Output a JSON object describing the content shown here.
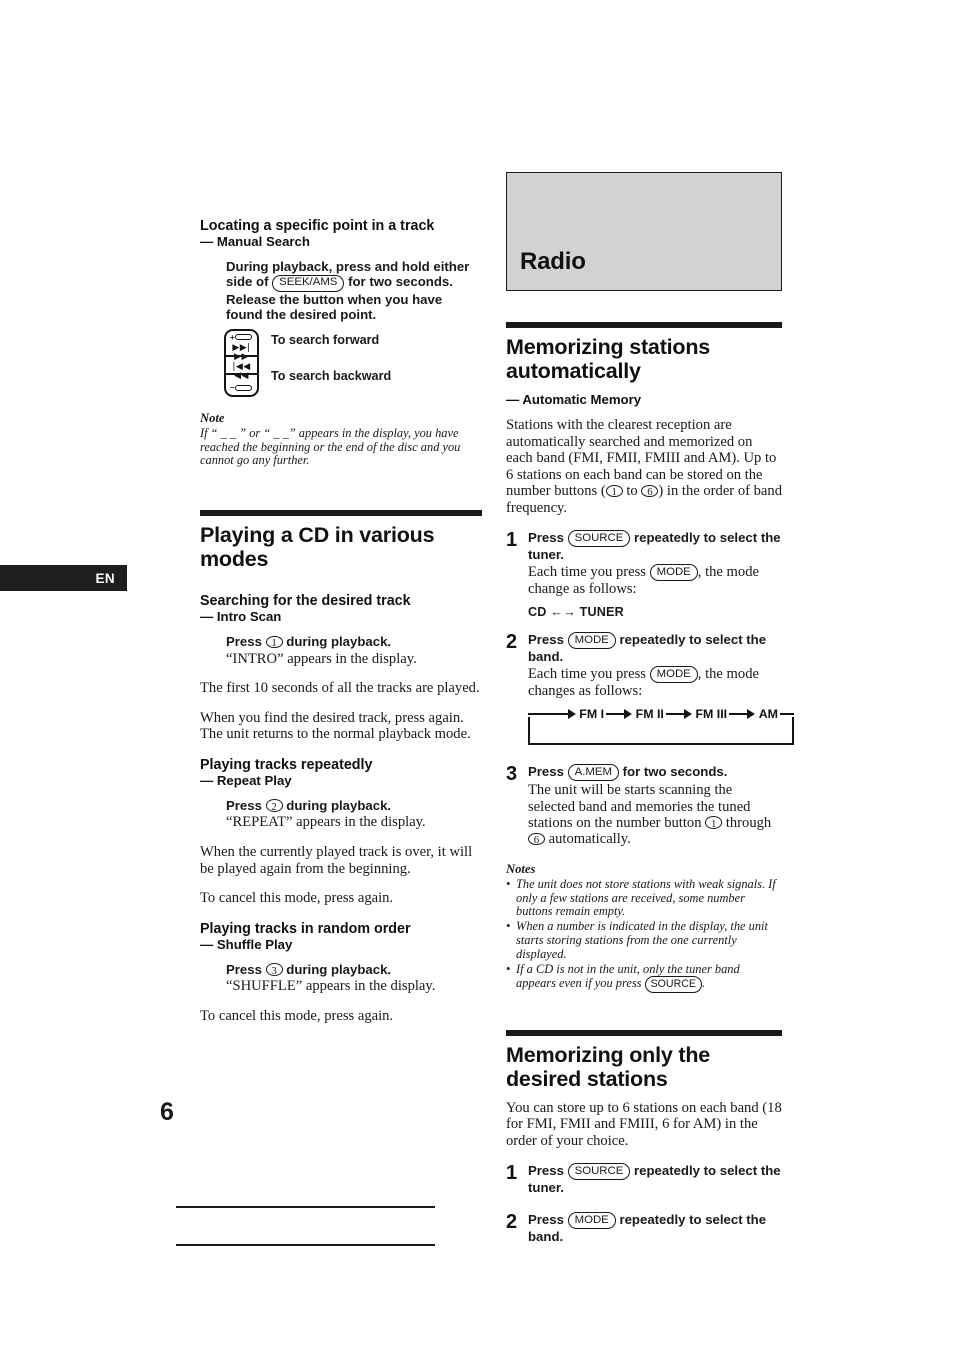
{
  "page": {
    "number": "6",
    "language_tab": "EN"
  },
  "left_column": {
    "section_manual_search": {
      "heading": "Locating a specific point in a track",
      "subheading": "— Manual Search",
      "instruction_pre": "During playback, press and hold either side of",
      "instruction_button": "SEEK/AMS",
      "instruction_post": "for two seconds. Release the button when you have found the desired point.",
      "illustration": {
        "forward_label": "To search forward",
        "backward_label": "To search backward",
        "plus_sign": "+",
        "minus_sign": "–",
        "forward_arrows": "▶▶| ▶▶",
        "backward_arrows": "|◀◀ ◀◀"
      },
      "note_heading": "Note",
      "note_text": "If “ _ _     ” or “     _ _” appears in the display, you have reached the beginning or the end of the disc and you cannot go any further."
    },
    "section_various_modes": {
      "heading": "Playing a CD in various modes",
      "intro_scan": {
        "heading": "Searching for the desired track",
        "subheading": "— Intro Scan",
        "instruction_pre": "Press",
        "instruction_button": "1",
        "instruction_post": "during playback.",
        "display_text": "“INTRO” appears in the display.",
        "paragraph_1": "The first 10 seconds of all the tracks are played.",
        "paragraph_2": "When you find the desired track, press again. The unit returns to the normal playback mode."
      },
      "repeat_play": {
        "heading": "Playing tracks repeatedly",
        "subheading": "— Repeat Play",
        "instruction_pre": "Press",
        "instruction_button": "2",
        "instruction_post": "during playback.",
        "display_text": "“REPEAT” appears in the display.",
        "paragraph_1": "When the currently played track is over, it will be played again from the beginning.",
        "paragraph_2": "To cancel this mode, press again."
      },
      "shuffle_play": {
        "heading": "Playing tracks in random order",
        "subheading": "— Shuffle Play",
        "instruction_pre": "Press",
        "instruction_button": "3",
        "instruction_post": "during playback.",
        "display_text": "“SHUFFLE” appears in the display.",
        "paragraph_1": "To cancel this mode, press again."
      }
    }
  },
  "right_column": {
    "chapter": {
      "title": "Radio"
    },
    "section_automatic_memory": {
      "heading": "Memorizing stations automatically",
      "subheading": "— Automatic Memory",
      "intro_a": "Stations with the clearest reception are automatically searched and memorized on each band (FMI, FMII, FMIII and AM). Up to 6 stations on each band can be stored on the number buttons (",
      "intro_btn_1": "1",
      "intro_b": "to",
      "intro_btn_6": "6",
      "intro_c": ") in the order of band frequency.",
      "steps": [
        {
          "number": "1",
          "instr_pre": "Press",
          "instr_button": "SOURCE",
          "instr_post": "repeatedly to select the tuner.",
          "sub_pre": "Each time you press",
          "sub_button": "MODE",
          "sub_post": ", the mode change as follows:",
          "mode_line": "CD ←→ TUNER"
        },
        {
          "number": "2",
          "instr_pre": "Press",
          "instr_button": "MODE",
          "instr_post": "repeatedly to select the band.",
          "sub_pre": "Each time you press",
          "sub_button": "MODE",
          "sub_post": ", the mode changes as follows:",
          "band_sequence": [
            "FM I",
            "FM II",
            "FM III",
            "AM"
          ]
        },
        {
          "number": "3",
          "instr_pre": "Press",
          "instr_button": "A.MEM",
          "instr_post": "for two seconds.",
          "sub_a": "The unit will be starts scanning the selected band and memories the tuned stations on the number button",
          "sub_btn_1": "1",
          "sub_b": "through",
          "sub_btn_6": "6",
          "sub_c": "automatically."
        }
      ],
      "notes_heading": "Notes",
      "notes": [
        "The unit does not store stations with weak signals. If only a few stations are received, some number buttons remain empty.",
        "When a number is indicated in the display, the unit starts storing stations from the one currently displayed."
      ],
      "note_3_pre": "If a CD is not in the unit, only the tuner band appears even if you press",
      "note_3_button": "SOURCE",
      "note_3_post": "."
    },
    "section_desired_stations": {
      "heading": "Memorizing only the desired stations",
      "intro": "You can store up to 6 stations on each band (18 for FMI, FMII and FMIII, 6 for AM) in the order of your choice.",
      "steps": [
        {
          "number": "1",
          "instr_pre": "Press",
          "instr_button": "SOURCE",
          "instr_post": "repeatedly to select the tuner."
        },
        {
          "number": "2",
          "instr_pre": "Press",
          "instr_button": "MODE",
          "instr_post": "repeatedly to select the band."
        }
      ]
    }
  }
}
